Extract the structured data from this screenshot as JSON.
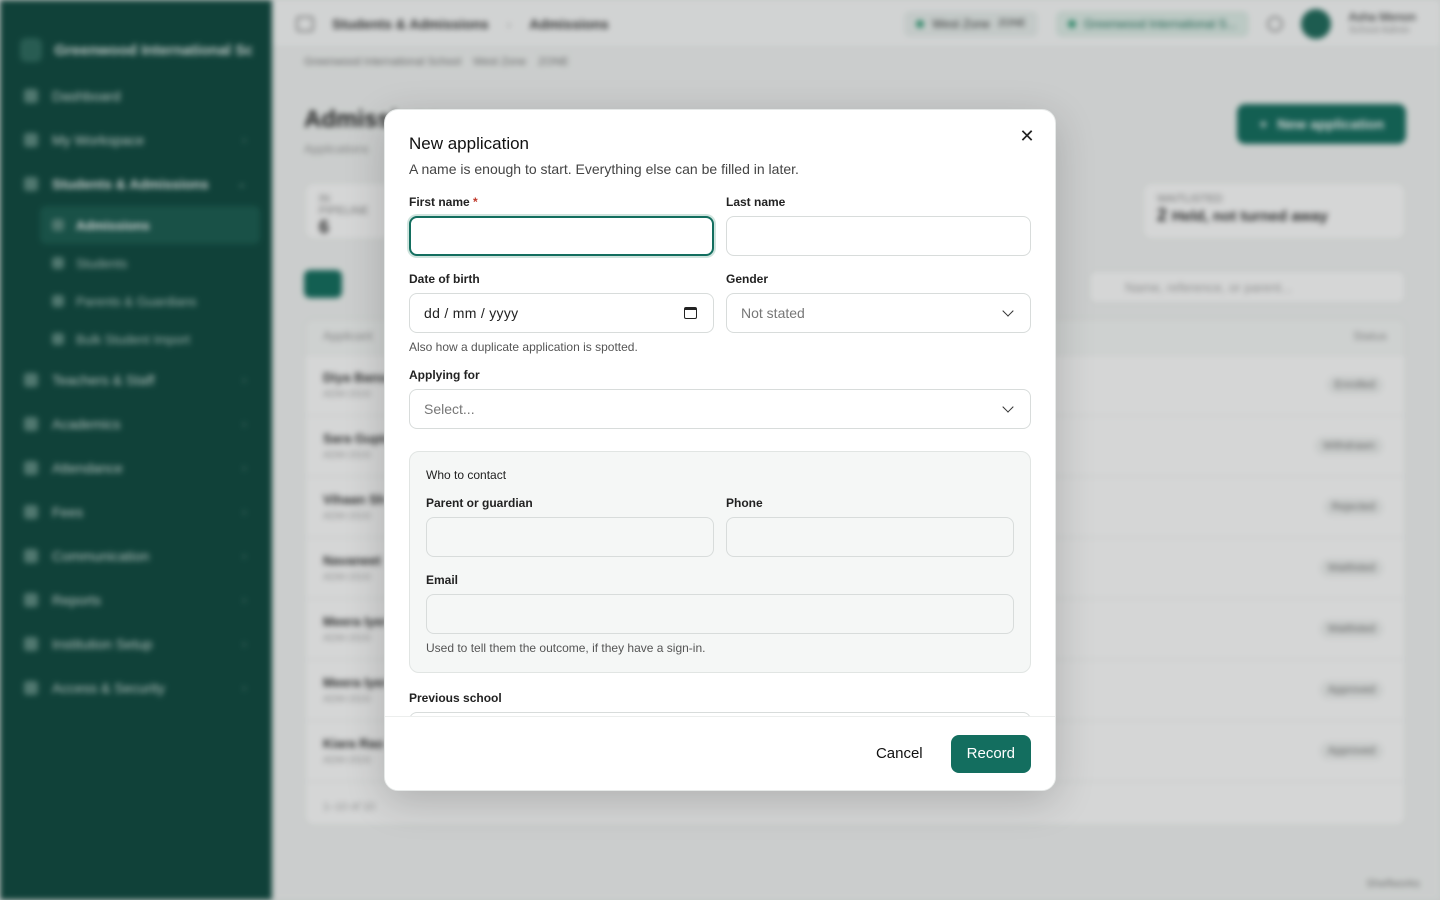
{
  "background": {
    "brand": "Greenwood International Sc...",
    "sidebar": {
      "items": [
        {
          "label": "Dashboard"
        },
        {
          "label": "My Workspace"
        },
        {
          "label": "Students & Admissions"
        },
        {
          "label": "Teachers & Staff"
        },
        {
          "label": "Academics"
        },
        {
          "label": "Attendance"
        },
        {
          "label": "Fees"
        },
        {
          "label": "Communication"
        },
        {
          "label": "Reports"
        },
        {
          "label": "Institution Setup"
        },
        {
          "label": "Access & Security"
        }
      ],
      "subitems": [
        {
          "label": "Admissions"
        },
        {
          "label": "Students"
        },
        {
          "label": "Parents & Guardians"
        },
        {
          "label": "Bulk Student Import"
        }
      ]
    },
    "topbar": {
      "crumb_parent": "Students & Admissions",
      "crumb_current": "Admissions",
      "zone": "West Zone",
      "zone_tag": "ZONE",
      "school_pill": "Greenwood International S...",
      "user_name": "Asha Menon",
      "user_role": "School Admin"
    },
    "subcrumbs": {
      "school": "Greenwood International School",
      "zone": "West Zone",
      "tag": "ZONE"
    },
    "page_title": "Admissions",
    "page_subtitle": "Applications",
    "new_application_label": "New application",
    "stats": [
      {
        "label": "IN PIPELINE",
        "value": "6"
      },
      {
        "label": "WAITLISTED",
        "value": "2",
        "note": "Held, not turned away"
      }
    ],
    "search_placeholder": "Name, reference, or parent...",
    "table": {
      "col_applicant": "Applicant",
      "col_status": "Status",
      "rows": [
        {
          "name": "Diya Bansal",
          "ref": "ADM-2024",
          "status": "Enrolled"
        },
        {
          "name": "Sara Gupta",
          "ref": "ADM-2024",
          "status": "Withdrawn"
        },
        {
          "name": "Vihaan Sh",
          "ref": "ADM-2024",
          "status": "Rejected"
        },
        {
          "name": "Navaneet",
          "ref": "ADM-2024",
          "status": "Waitlisted"
        },
        {
          "name": "Meera Iyer",
          "ref": "ADM-2024",
          "status": "Waitlisted"
        },
        {
          "name": "Meera Iyer",
          "ref": "ADM-2024",
          "status": "Approved"
        },
        {
          "name": "Kiara Rao",
          "ref": "ADM-2024",
          "status": "Approved"
        }
      ],
      "footer": "1–10 of 10"
    },
    "corner": "Shelfworks"
  },
  "modal": {
    "title": "New application",
    "description": "A name is enough to start. Everything else can be filled in later.",
    "first_name": {
      "label": "First name",
      "required_mark": "*",
      "value": ""
    },
    "last_name": {
      "label": "Last name",
      "value": ""
    },
    "dob": {
      "label": "Date of birth",
      "value": "dd / mm / yyyy",
      "hint": "Also how a duplicate application is spotted."
    },
    "gender": {
      "label": "Gender",
      "value": "Not stated"
    },
    "applying_for": {
      "label": "Applying for",
      "value": "Select..."
    },
    "contact": {
      "title": "Who to contact",
      "parent": {
        "label": "Parent or guardian",
        "value": ""
      },
      "phone": {
        "label": "Phone",
        "value": ""
      },
      "email": {
        "label": "Email",
        "value": "",
        "hint": "Used to tell them the outcome, if they have a sign-in."
      }
    },
    "previous_school": {
      "label": "Previous school",
      "value": ""
    },
    "cancel_label": "Cancel",
    "record_label": "Record"
  },
  "colors": {
    "accent": "#136e5f",
    "sidebar": "#0f4a40",
    "required": "#c0392b"
  }
}
